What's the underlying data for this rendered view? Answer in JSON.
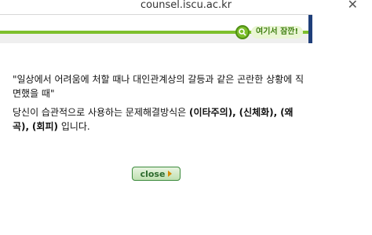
{
  "browser": {
    "url": "counsel.iscu.ac.kr",
    "close_glyph": "✕"
  },
  "banner": {
    "tag_label": "여기서 잠깐!",
    "tag_icon": "magnifier-icon",
    "accent_color": "#7dbf2c"
  },
  "content": {
    "quote": "\"일상에서 어려움에 처할 때나 대인관계상의 갈등과 같은 곤란한 상황에 직면했을 때\"",
    "answer_prefix": "당신이 습관적으로 사용하는 문제해결방식은",
    "answer_options": [
      "(이타주의),",
      "(신체화),",
      "(왜곡),",
      "(회피)"
    ],
    "answer_suffix": "입니다."
  },
  "close_button": {
    "label": "close"
  }
}
